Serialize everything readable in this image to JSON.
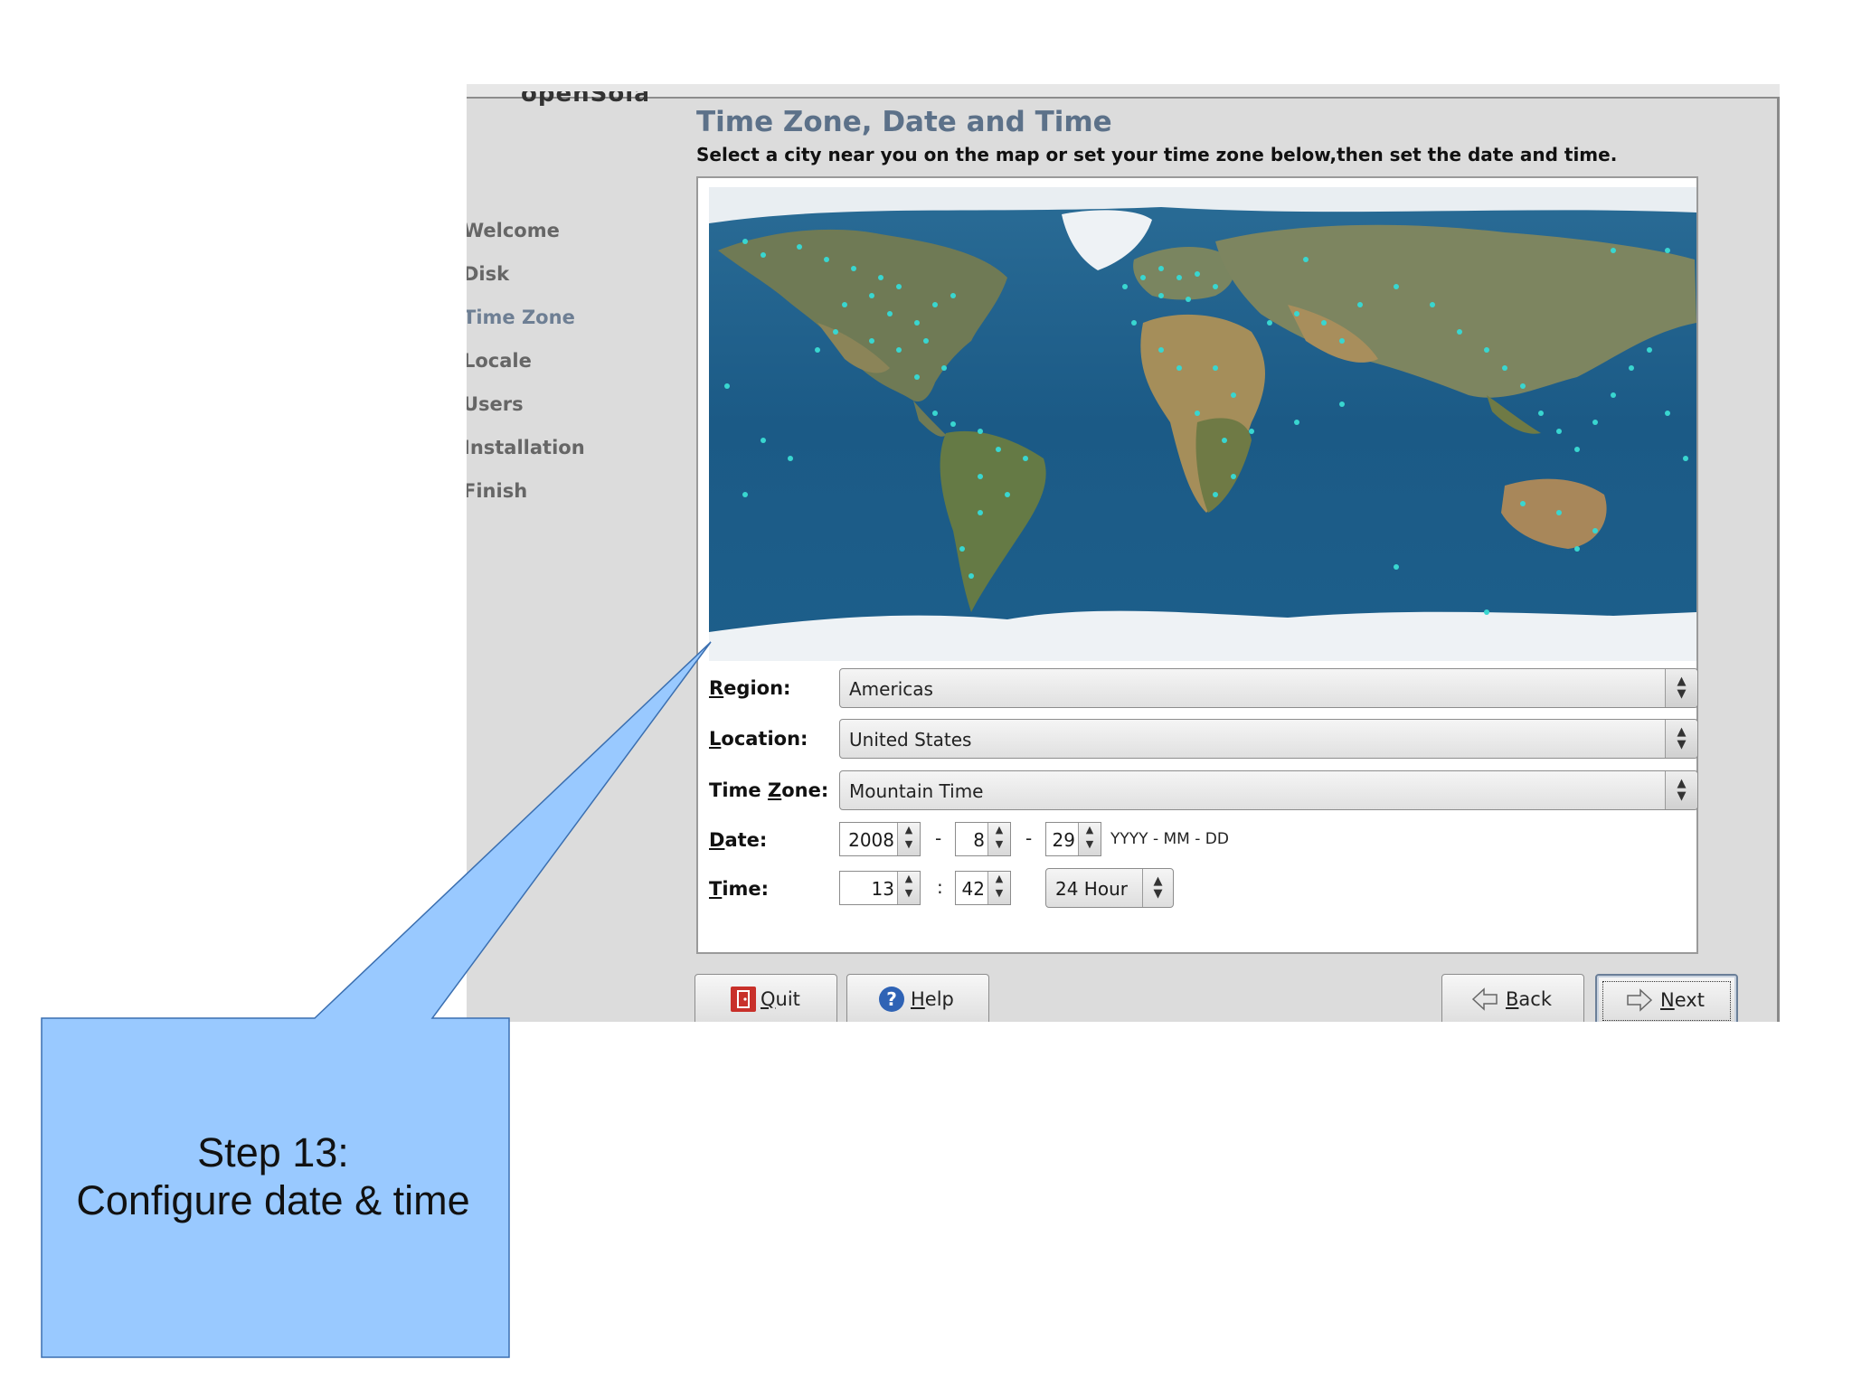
{
  "window": {
    "logo_fragment": "openSolaris"
  },
  "sidebar": {
    "items": [
      {
        "label": "Welcome"
      },
      {
        "label": "Disk"
      },
      {
        "label": "Time Zone"
      },
      {
        "label": "Locale"
      },
      {
        "label": "Users"
      },
      {
        "label": "Installation"
      },
      {
        "label": "Finish"
      }
    ],
    "active_index": 2
  },
  "header": {
    "title": "Time Zone, Date and Time",
    "subtitle": "Select a city near you on the map or set your time zone below,then set the date and time."
  },
  "form": {
    "region": {
      "label_prefix": "",
      "label_mnemonic": "R",
      "label_rest": "egion:",
      "value": "Americas"
    },
    "location": {
      "label_prefix": "",
      "label_mnemonic": "L",
      "label_rest": "ocation:",
      "value": "United States"
    },
    "timezone": {
      "label_prefix": "Time ",
      "label_mnemonic": "Z",
      "label_rest": "one:",
      "value": "Mountain Time"
    },
    "date": {
      "label_prefix": "",
      "label_mnemonic": "D",
      "label_rest": "ate:",
      "year": "2008",
      "month": "8",
      "day": "29",
      "sep": "-",
      "format_hint": "YYYY - MM - DD"
    },
    "time": {
      "label_prefix": "",
      "label_mnemonic": "T",
      "label_rest": "ime:",
      "hour": "13",
      "minute": "42",
      "sep": ":",
      "mode": "24 Hour"
    }
  },
  "buttons": {
    "quit": {
      "mnemonic": "Q",
      "rest": "uit"
    },
    "help": {
      "mnemonic": "H",
      "rest": "elp"
    },
    "back": {
      "mnemonic": "B",
      "rest": "ack"
    },
    "next": {
      "mnemonic": "N",
      "rest": "ext"
    }
  },
  "callout": {
    "line1": "Step 13:",
    "line2": "Configure date & time"
  },
  "colors": {
    "ocean": "#1f5e88",
    "city_dot": "#39d6d0",
    "callout_fill": "#99c9ff",
    "title": "#5c7189"
  }
}
